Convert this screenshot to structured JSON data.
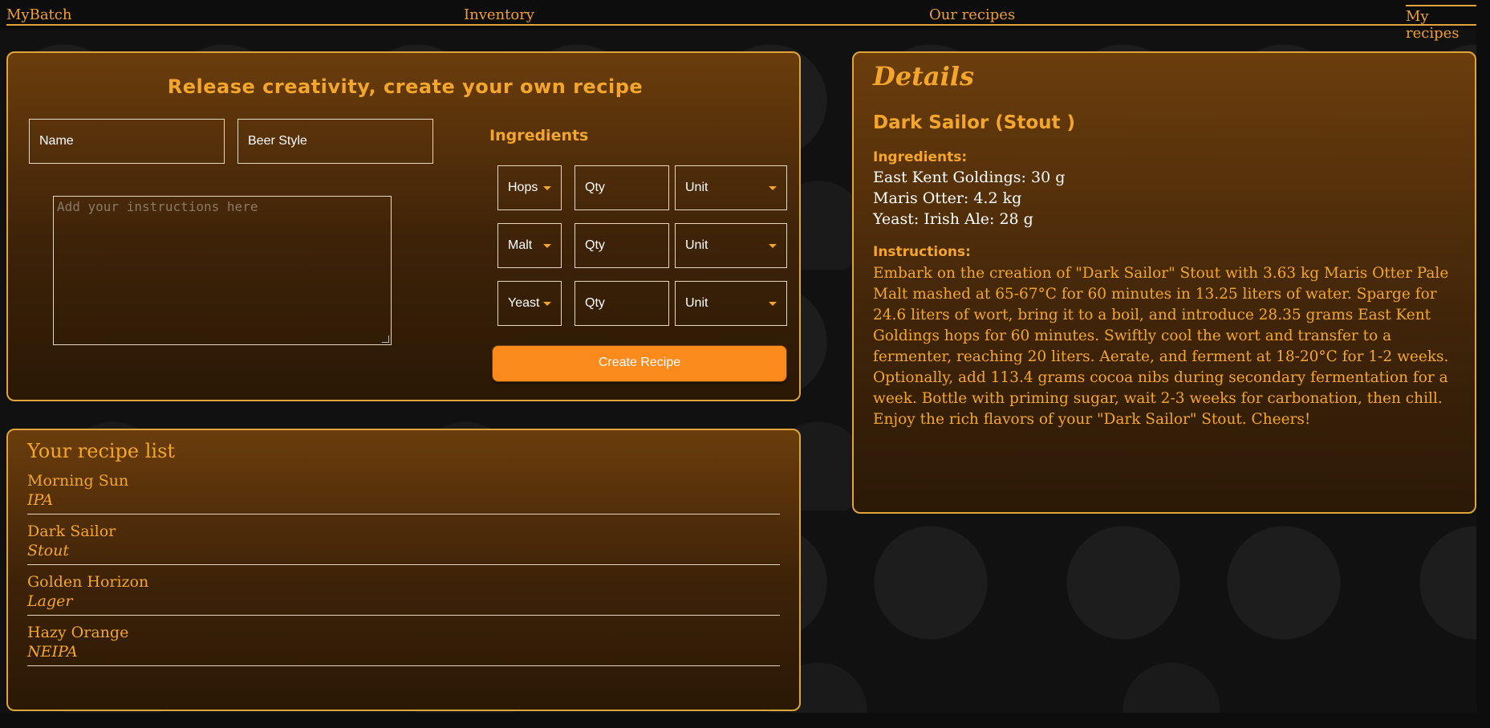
{
  "nav": {
    "brand": "MyBatch",
    "items": [
      "Inventory",
      "Our recipes",
      "My recipes"
    ]
  },
  "create": {
    "title": "Release creativity, create your own recipe",
    "name_placeholder": "Name",
    "style_placeholder": "Beer Style",
    "instructions_placeholder": "Add your instructions here",
    "ingredients_label": "Ingredients",
    "rows": [
      {
        "type": "Hops",
        "qty": "Qty",
        "unit": "Unit"
      },
      {
        "type": "Malt",
        "qty": "Qty",
        "unit": "Unit"
      },
      {
        "type": "Yeast",
        "qty": "Qty",
        "unit": "Unit"
      }
    ],
    "button": "Create Recipe"
  },
  "list": {
    "title": "Your recipe list",
    "items": [
      {
        "name": "Morning Sun",
        "style": "IPA"
      },
      {
        "name": "Dark Sailor",
        "style": "Stout"
      },
      {
        "name": "Golden Horizon",
        "style": "Lager"
      },
      {
        "name": "Hazy Orange",
        "style": "NEIPA"
      }
    ]
  },
  "details": {
    "title": "Details",
    "recipe": "Dark Sailor (Stout )",
    "ingredients_label": "Ingredients:",
    "ingredients": [
      "East Kent Goldings: 30 g",
      "Maris Otter: 4.2 kg",
      "Yeast: Irish Ale: 28 g"
    ],
    "instructions_label": "Instructions:",
    "instructions": "Embark on the creation of \"Dark Sailor\" Stout with 3.63 kg Maris Otter Pale Malt mashed at 65-67°C for 60 minutes in 13.25 liters of water. Sparge for 24.6 liters of wort, bring it to a boil, and introduce 28.35 grams East Kent Goldings hops for 60 minutes. Swiftly cool the wort and transfer to a fermenter, reaching 20 liters. Aerate, and ferment at 18-20°C for 1-2 weeks. Optionally, add 113.4 grams cocoa nibs during secondary fermentation for a week. Bottle with priming sugar, wait 2-3 weeks for carbonation, then chill. Enjoy the rich flavors of your \"Dark Sailor\" Stout. Cheers!"
  },
  "colors": {
    "accent": "#f4a62c",
    "button": "#fb8a1c",
    "border": "#e0a43a"
  }
}
